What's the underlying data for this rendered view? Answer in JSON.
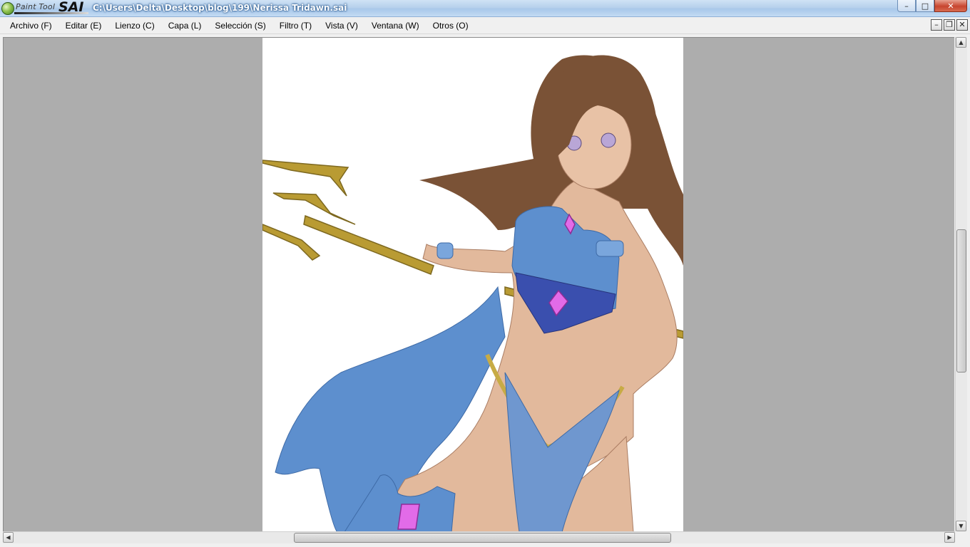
{
  "window": {
    "app_logo_small": "Paint Tool",
    "app_logo_big": "SAI",
    "title": "C:\\Users\\Delta\\Desktop\\blog\\199\\Nerissa Tridawn.sai",
    "buttons": {
      "minimize": "–",
      "maximize": "□",
      "close": "✕"
    }
  },
  "menu": {
    "items": [
      {
        "label": "Archivo (F)"
      },
      {
        "label": "Editar (E)"
      },
      {
        "label": "Lienzo (C)"
      },
      {
        "label": "Capa (L)"
      },
      {
        "label": "Selección (S)"
      },
      {
        "label": "Filtro (T)"
      },
      {
        "label": "Vista (V)"
      },
      {
        "label": "Ventana (W)"
      },
      {
        "label": "Otros (O)"
      }
    ],
    "mdi_buttons": {
      "minimize": "–",
      "restore": "❐",
      "close": "✕"
    }
  },
  "canvas": {
    "image_name": "Nerissa Tridawn",
    "background_color": "#ffffff",
    "workspace_color": "#adadad"
  },
  "scrollbars": {
    "up_arrow": "▲",
    "down_arrow": "▼",
    "left_arrow": "◀",
    "right_arrow": "▶"
  },
  "colors": {
    "hair": "#7a5236",
    "skin": "#e2b99c",
    "outfit_blue": "#5d8fce",
    "outfit_dark": "#3a4fae",
    "gem": "#e26be8",
    "gold": "#b99b33"
  }
}
